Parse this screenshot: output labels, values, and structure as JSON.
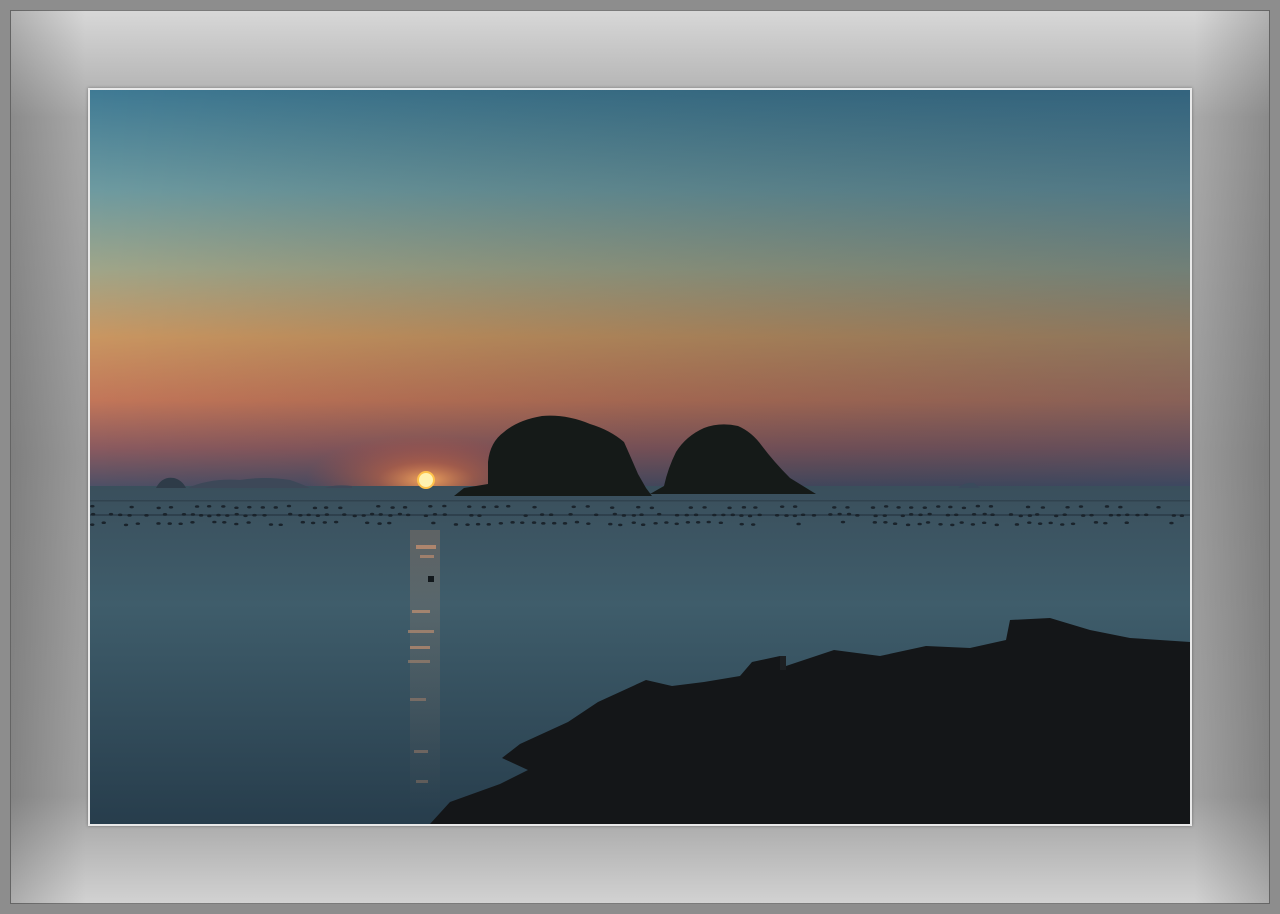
{
  "image": {
    "subject": "",
    "colors": {
      "sky_top": "#3f7a92",
      "sky_mid": "#8fa7a0",
      "sky_warm": "#c9915e",
      "sky_horizon": "#b5634f",
      "sun": "#ff8a2a",
      "sea": "#3f5b69",
      "silhouette": "#141618",
      "frame": "#9a9a9a",
      "border": "#e9e9e9"
    }
  }
}
